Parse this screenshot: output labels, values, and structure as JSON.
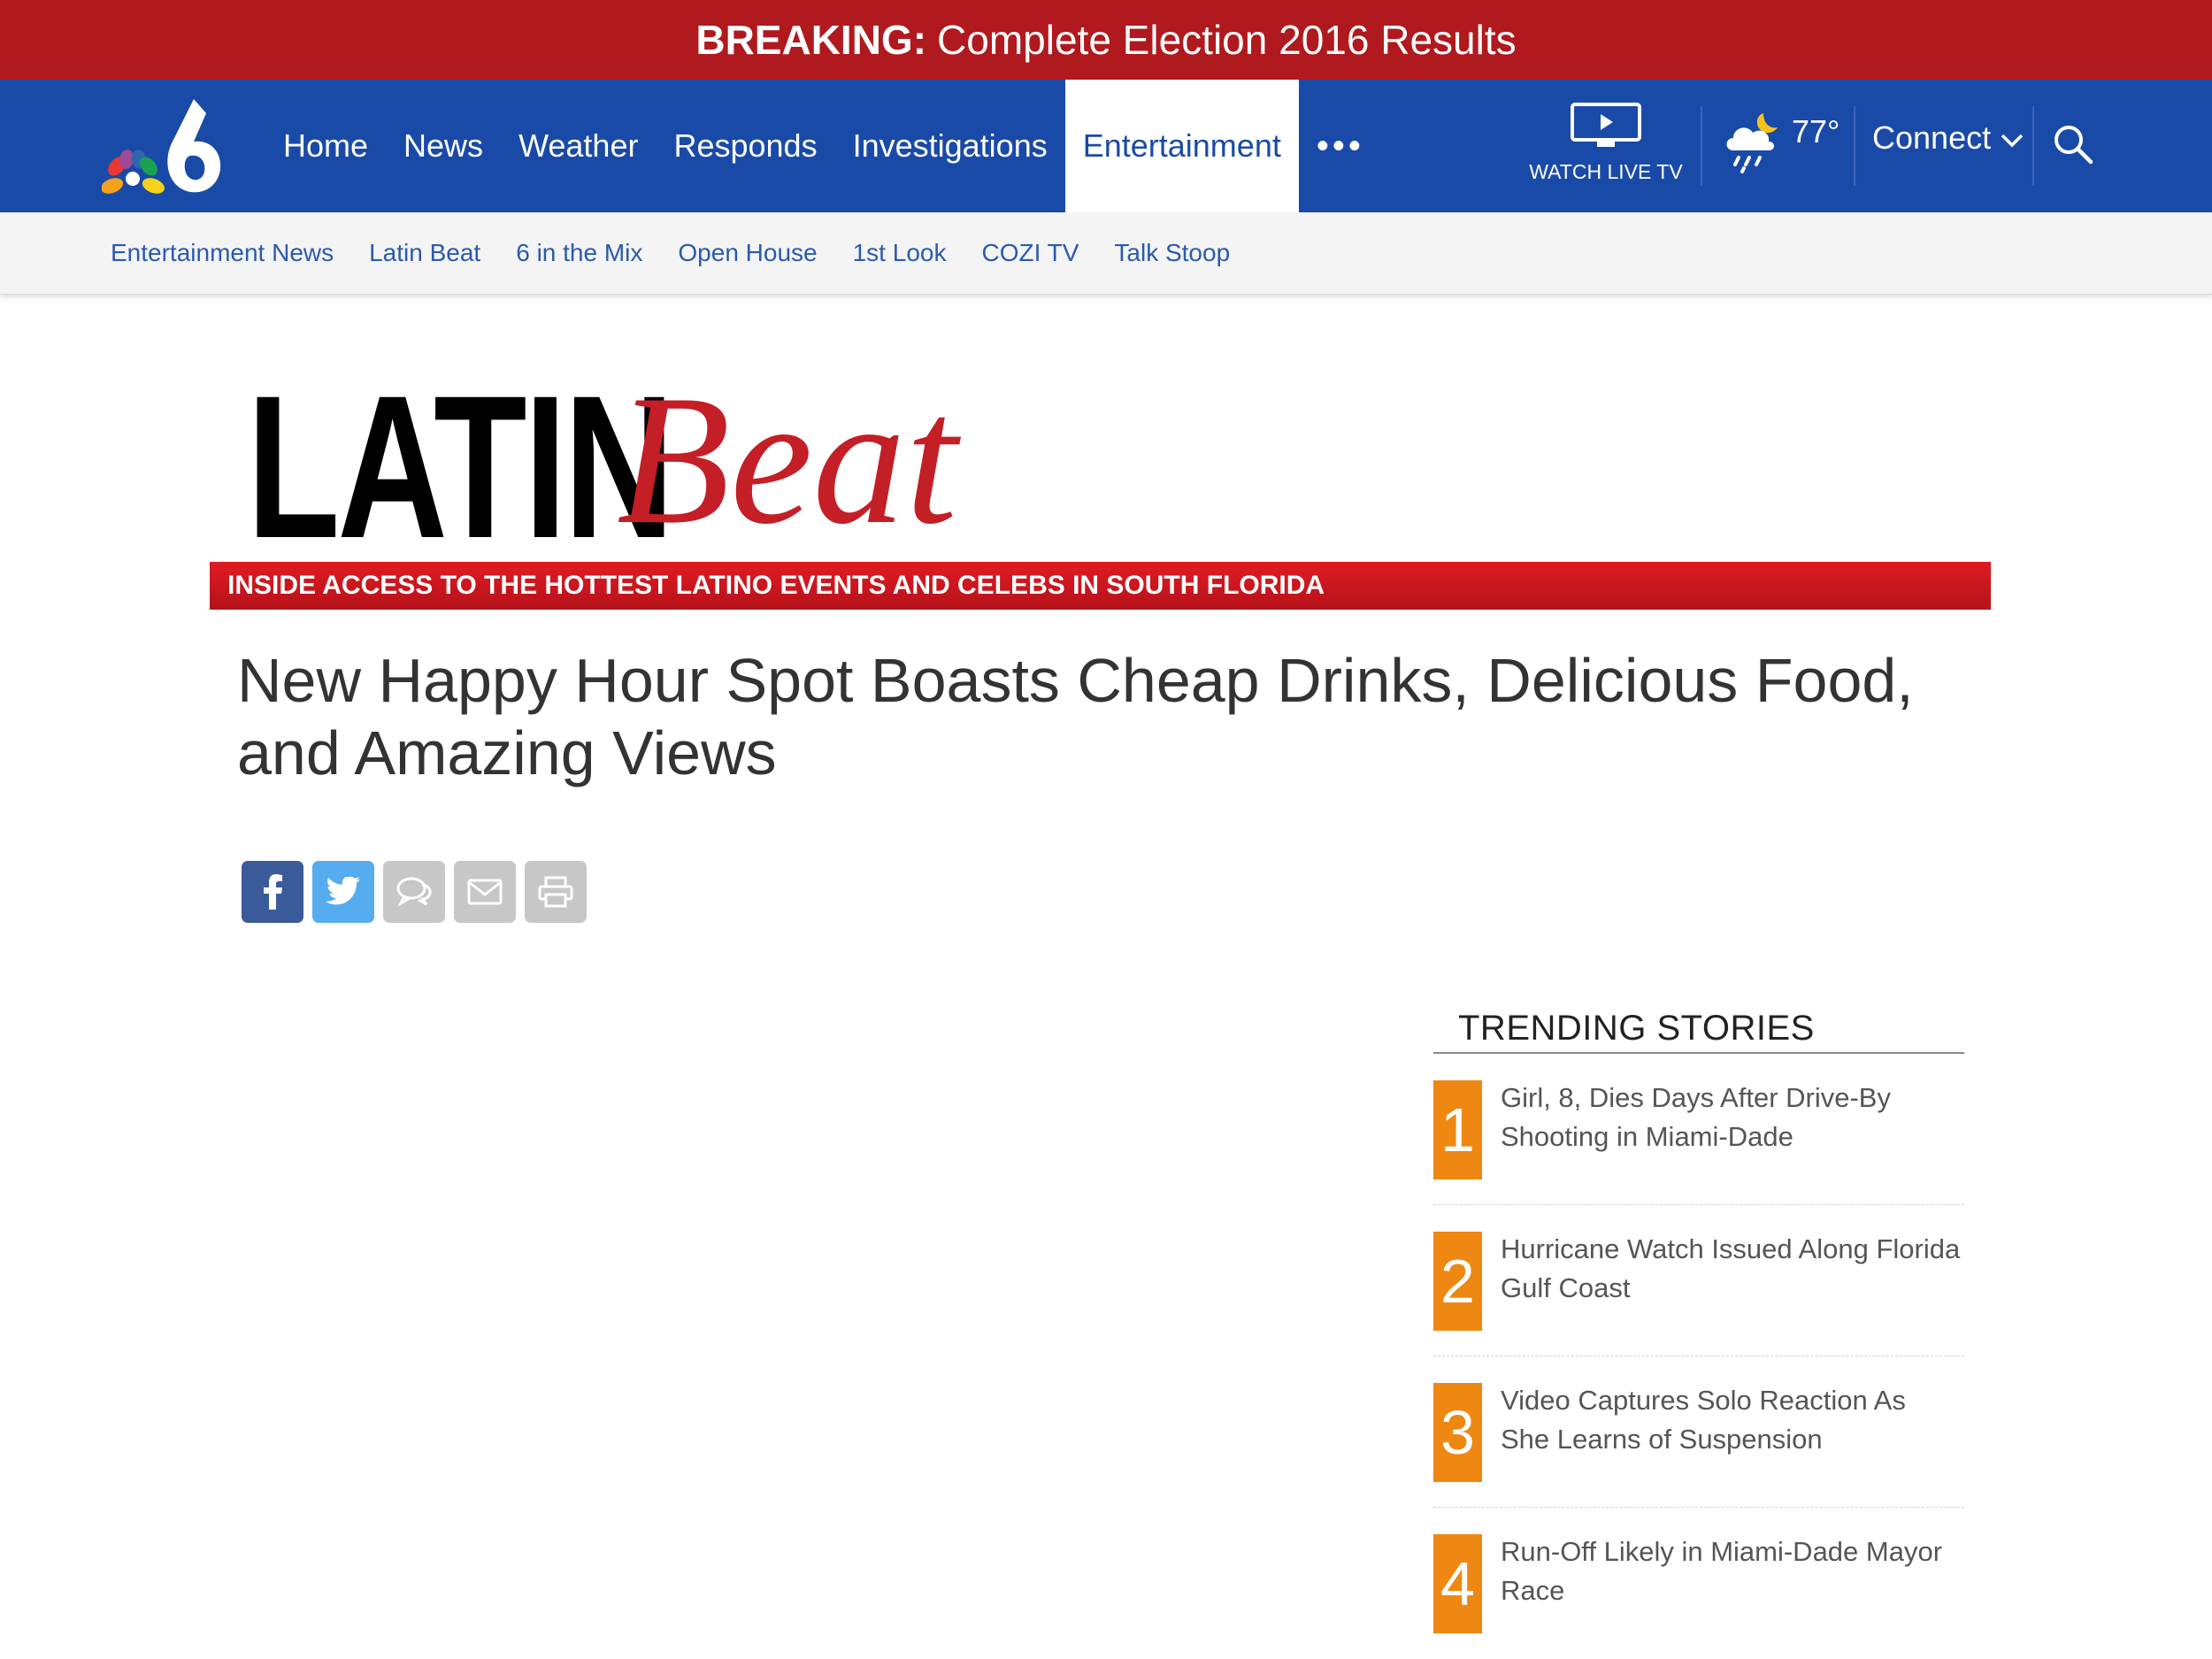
{
  "breaking": {
    "label": "BREAKING:",
    "text": "Complete Election 2016 Results"
  },
  "nav": {
    "items": [
      {
        "label": "Home"
      },
      {
        "label": "News"
      },
      {
        "label": "Weather"
      },
      {
        "label": "Responds"
      },
      {
        "label": "Investigations"
      },
      {
        "label": "Entertainment"
      }
    ],
    "more": "•••",
    "watch_live": "WATCH LIVE TV",
    "temperature": "77°",
    "connect": "Connect"
  },
  "subnav": {
    "items": [
      {
        "label": "Entertainment News"
      },
      {
        "label": "Latin Beat"
      },
      {
        "label": "6 in the Mix"
      },
      {
        "label": "Open House"
      },
      {
        "label": "1st Look"
      },
      {
        "label": "COZI TV"
      },
      {
        "label": "Talk Stoop"
      }
    ]
  },
  "banner": {
    "word1": "LATIN",
    "word2": "Beat",
    "tagline": "INSIDE ACCESS TO THE HOTTEST LATINO EVENTS AND CELEBS IN SOUTH FLORIDA"
  },
  "article": {
    "headline": "New Happy Hour Spot Boasts Cheap Drinks, Delicious Food, and Amazing Views"
  },
  "share": {
    "buttons": [
      "facebook-icon",
      "twitter-icon",
      "comment-icon",
      "email-icon",
      "print-icon"
    ],
    "colors": {
      "facebook": "#3b5a9a",
      "twitter": "#55acee",
      "grey": "#c7c7c7"
    }
  },
  "trending": {
    "title": "TRENDING STORIES",
    "items": [
      {
        "rank": "1",
        "title": "Girl, 8, Dies Days After Drive-By Shooting in Miami-Dade"
      },
      {
        "rank": "2",
        "title": "Hurricane Watch Issued Along Florida Gulf Coast"
      },
      {
        "rank": "3",
        "title": "Video Captures Solo Reaction As She Learns of Suspension"
      },
      {
        "rank": "4",
        "title": "Run-Off Likely in Miami-Dade Mayor Race"
      }
    ]
  },
  "colors": {
    "breaking_red": "#b0191d",
    "nav_blue": "#1a4aa8",
    "subnav_link": "#2a5aad",
    "trending_orange": "#ee8812"
  }
}
